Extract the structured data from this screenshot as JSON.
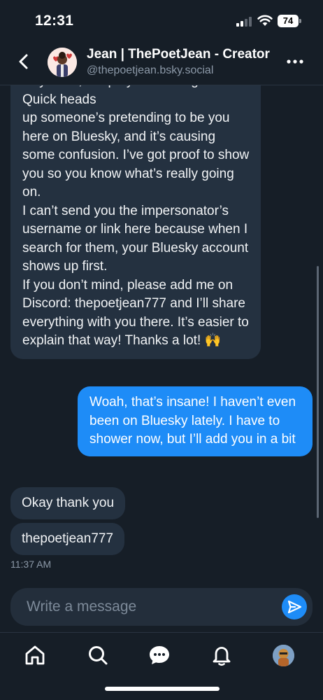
{
  "status_bar": {
    "time": "12:31",
    "battery": "74"
  },
  "header": {
    "title": "Jean | ThePoetJean - Creator",
    "handle": "@thepoetjean.bsky.social"
  },
  "messages": [
    {
      "direction": "incoming",
      "lines": [
        "Hey Jean, I hope you're doing well. Quick heads",
        "up someone’s pretending to be you here on Bluesky, and it’s causing some confusion. I’ve got proof to show you so you know what’s really going on.",
        "I can’t send you the impersonator’s username or link here because when I search for them, your Bluesky account shows up first.",
        "If you don’t mind, please add me on Discord: thepoetjean777 and I’ll share everything with you there. It’s easier to explain that way! Thanks a lot! 🙌"
      ]
    },
    {
      "direction": "outgoing",
      "text": "Woah, that’s insane! I haven’t even been on Bluesky lately. I have to shower now, but I’ll add you in a bit"
    },
    {
      "direction": "incoming",
      "text": "Okay thank you"
    },
    {
      "direction": "incoming",
      "text": "thepoetjean777"
    }
  ],
  "last_timestamp": "11:37 AM",
  "composer": {
    "placeholder": "Write a message"
  },
  "icons": {
    "back": "chevron-left-icon",
    "more": "ellipsis-icon",
    "send": "send-icon",
    "tabs": [
      "home-icon",
      "search-icon",
      "chat-icon",
      "bell-icon",
      "profile-avatar"
    ]
  },
  "colors": {
    "background": "#161e27",
    "incoming_bubble": "#243140",
    "outgoing_bubble": "#1e8cf7",
    "secondary_text": "#8c99a8"
  }
}
